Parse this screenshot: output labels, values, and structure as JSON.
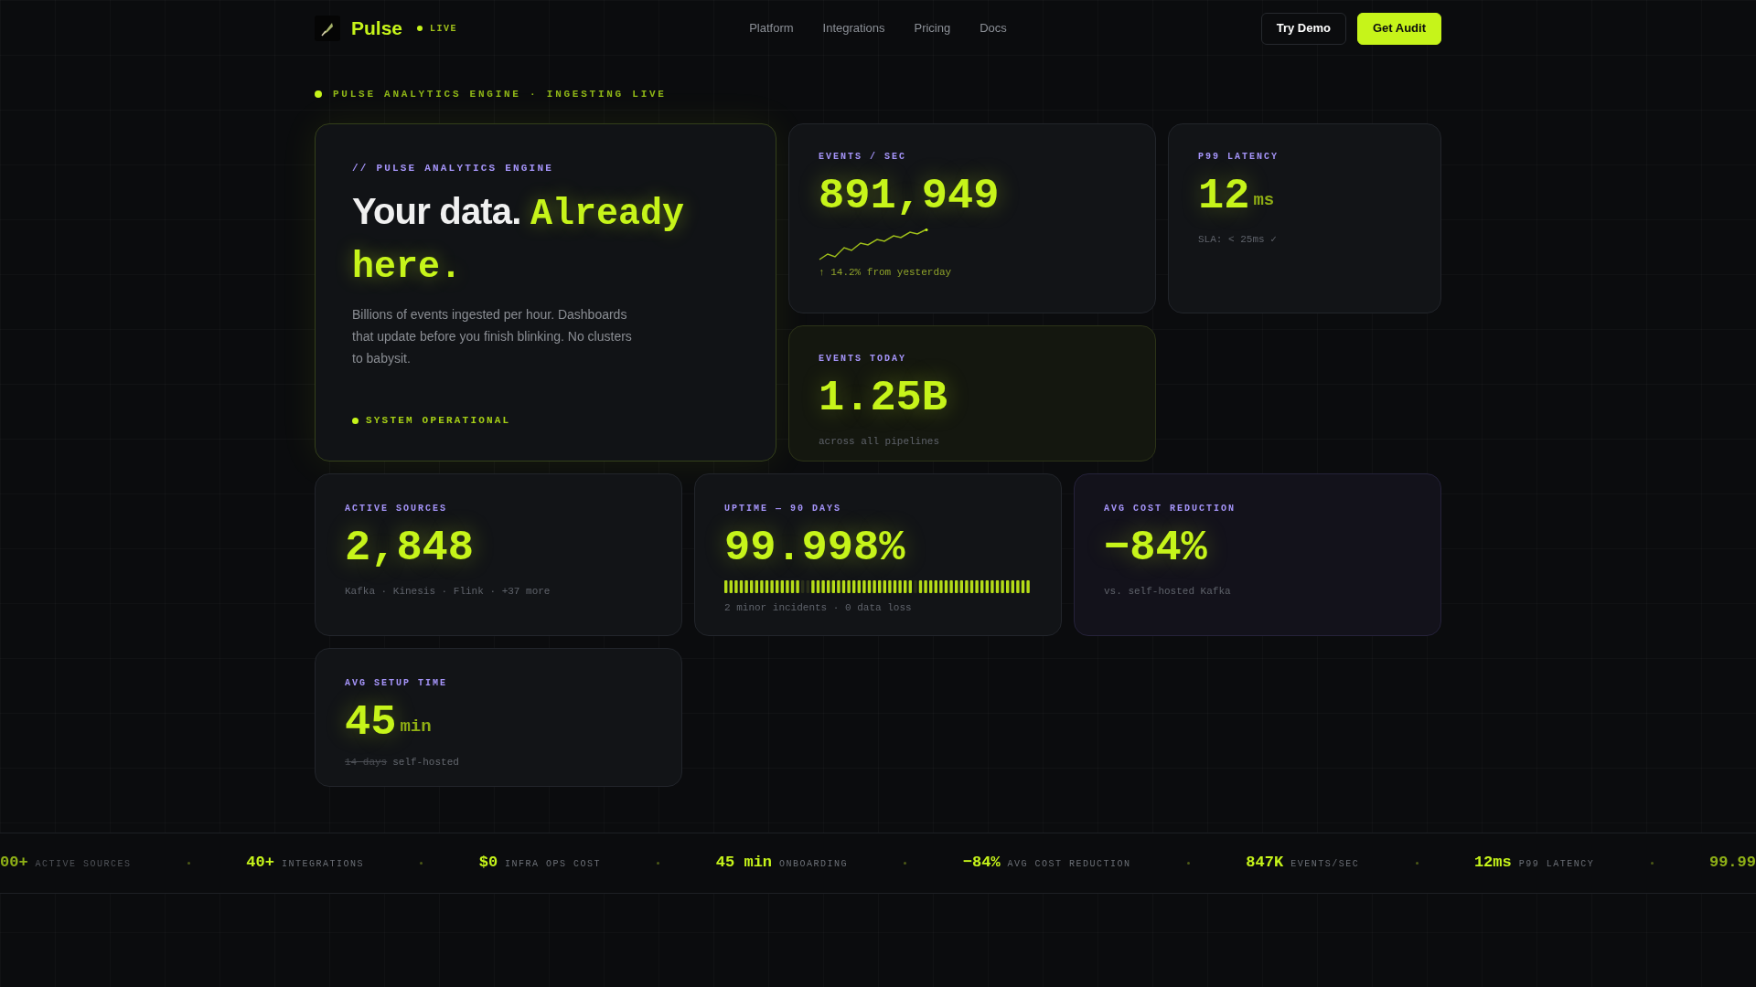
{
  "brand": {
    "name": "Pulse",
    "badge": "LIVE"
  },
  "nav": [
    {
      "label": "Platform"
    },
    {
      "label": "Integrations"
    },
    {
      "label": "Pricing"
    },
    {
      "label": "Docs"
    }
  ],
  "actions": [
    {
      "label": "Try Demo",
      "kind": "secondary"
    },
    {
      "label": "Get Audit",
      "kind": "primary"
    }
  ],
  "status_line": "PULSE ANALYTICS ENGINE · INGESTING LIVE",
  "hero": {
    "eyebrow": "// PULSE ANALYTICS ENGINE",
    "title_plain": "Your data.",
    "title_accent": "Already here.",
    "body": "Billions of events ingested per hour. Dashboards that update before you finish blinking. No clusters to babysit.",
    "status": "SYSTEM OPERATIONAL"
  },
  "stats": [
    {
      "kind": "sparkline",
      "label": "EVENTS / SEC",
      "value": "891,949",
      "note": "↑ 14.2% from yesterday"
    },
    {
      "kind": "unit",
      "label": "P99 LATENCY",
      "value": "12",
      "unit": "ms",
      "note": "SLA: < 25ms ✓"
    },
    {
      "kind": "plain",
      "label": "EVENTS TODAY",
      "value": "1.25B",
      "note": "across all pipelines"
    },
    {
      "kind": "plain",
      "label": "ACTIVE SOURCES",
      "value": "2,848",
      "note": "Kafka · Kinesis · Flink · +37 more"
    },
    {
      "kind": "uptime",
      "label": "UPTIME — 90 DAYS",
      "value": "99.998%",
      "note": "2 minor incidents · 0 data loss"
    },
    {
      "kind": "plain",
      "label": "AVG COST REDUCTION",
      "value": "−84%",
      "note": "vs. self-hosted Kafka"
    },
    {
      "kind": "strike",
      "label": "AVG SETUP TIME",
      "value": "45",
      "unit": "min",
      "struck": "14 days",
      "note": "self-hosted"
    }
  ],
  "ticker": [
    {
      "value": "00+",
      "label": "ACTIVE SOURCES"
    },
    {
      "value": "40+",
      "label": "INTEGRATIONS"
    },
    {
      "value": "$0",
      "label": "INFRA OPS COST"
    },
    {
      "value": "45 min",
      "label": "ONBOARDING"
    },
    {
      "value": "−84%",
      "label": "AVG COST REDUCTION"
    },
    {
      "value": "847K",
      "label": "EVENTS/SEC"
    },
    {
      "value": "12ms",
      "label": "P99 LATENCY"
    },
    {
      "value": "99.99"
    }
  ]
}
